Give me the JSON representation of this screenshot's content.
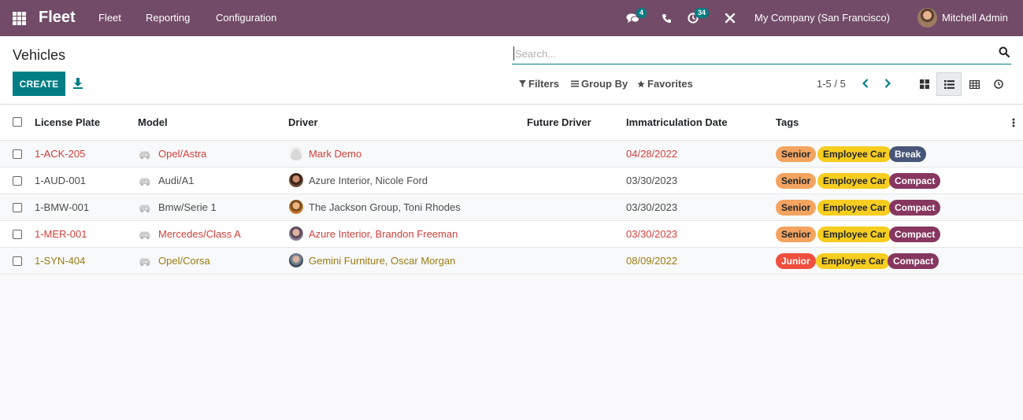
{
  "navbar": {
    "brand": "Fleet",
    "menu": [
      "Fleet",
      "Reporting",
      "Configuration"
    ],
    "messages_count": "4",
    "activities_count": "34",
    "company": "My Company (San Francisco)",
    "user": "Mitchell Admin"
  },
  "control_panel": {
    "title": "Vehicles",
    "create_label": "CREATE",
    "search_placeholder": "Search...",
    "filters_label": "Filters",
    "group_by_label": "Group By",
    "favorites_label": "Favorites",
    "pager": "1-5 / 5"
  },
  "table": {
    "columns": [
      "License Plate",
      "Model",
      "Driver",
      "Future Driver",
      "Immatriculation Date",
      "Tags"
    ],
    "rows": [
      {
        "plate": "1-ACK-205",
        "model": "Opel/Astra",
        "driver": "Mark Demo",
        "future_driver": "",
        "date": "04/28/2022",
        "tags": [
          "Senior",
          "Employee Car",
          "Break"
        ],
        "text_color": "#d23f3a"
      },
      {
        "plate": "1-AUD-001",
        "model": "Audi/A1",
        "driver": "Azure Interior, Nicole Ford",
        "future_driver": "",
        "date": "03/30/2023",
        "tags": [
          "Senior",
          "Employee Car",
          "Compact"
        ],
        "text_color": "#4c4c4c"
      },
      {
        "plate": "1-BMW-001",
        "model": "Bmw/Serie 1",
        "driver": "The Jackson Group, Toni Rhodes",
        "future_driver": "",
        "date": "03/30/2023",
        "tags": [
          "Senior",
          "Employee Car",
          "Compact"
        ],
        "text_color": "#4c4c4c"
      },
      {
        "plate": "1-MER-001",
        "model": "Mercedes/Class A",
        "driver": "Azure Interior, Brandon Freeman",
        "future_driver": "",
        "date": "03/30/2023",
        "tags": [
          "Senior",
          "Employee Car",
          "Compact"
        ],
        "text_color": "#d23f3a"
      },
      {
        "plate": "1-SYN-404",
        "model": "Opel/Corsa",
        "driver": "Gemini Furniture, Oscar Morgan",
        "future_driver": "",
        "date": "08/09/2022",
        "tags": [
          "Junior",
          "Employee Car",
          "Compact"
        ],
        "text_color": "#9a7b12"
      }
    ]
  },
  "tag_colors": {
    "Senior": {
      "bg": "#f4a460",
      "fg": "#212529"
    },
    "Junior": {
      "bg": "#f04e3e",
      "fg": "#ffffff"
    },
    "Employee Car": {
      "bg": "#f7cd1f",
      "fg": "#212529"
    },
    "Break": {
      "bg": "#475577",
      "fg": "#ffffff"
    },
    "Compact": {
      "bg": "#87375f",
      "fg": "#ffffff"
    }
  }
}
